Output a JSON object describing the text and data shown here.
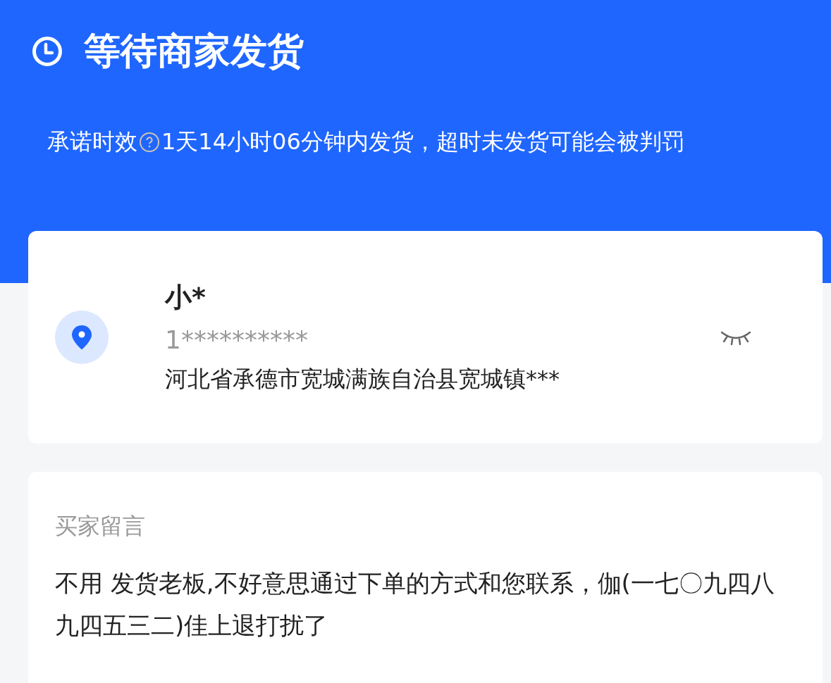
{
  "header": {
    "title": "等待商家发货",
    "promise_label": "承诺时效",
    "promise_text": "1天14小时06分钟内发货，超时未发货可能会被判罚"
  },
  "address": {
    "name": "小*",
    "phone": "1**********",
    "address": "河北省承德市宽城满族自治县宽城镇***",
    "masked": true
  },
  "buyer_note": {
    "label": "买家留言",
    "message": "不用 发货老板,不好意思通过下单的方式和您联系，伽(一七〇九四八九四五三二)佳上退打扰了"
  }
}
